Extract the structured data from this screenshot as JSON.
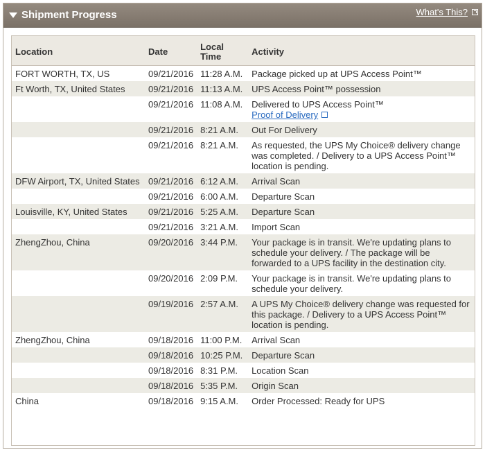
{
  "panel": {
    "title": "Shipment Progress",
    "help_link": "What's This?"
  },
  "columns": {
    "location": "Location",
    "date": "Date",
    "time_line1": "Local",
    "time_line2": "Time",
    "activity": "Activity"
  },
  "rows": [
    {
      "location": "FORT WORTH, TX, US",
      "date": "09/21/2016",
      "time": "11:28 A.M.",
      "activity": "Package picked up at UPS Access Point™",
      "link": ""
    },
    {
      "location": "Ft Worth, TX, United States",
      "date": "09/21/2016",
      "time": "11:13 A.M.",
      "activity": "UPS Access Point™ possession",
      "link": ""
    },
    {
      "location": "",
      "date": "09/21/2016",
      "time": "11:08 A.M.",
      "activity": "Delivered to UPS Access Point™",
      "link": "Proof of Delivery"
    },
    {
      "location": "",
      "date": "09/21/2016",
      "time": "8:21 A.M.",
      "activity": "Out For Delivery",
      "link": ""
    },
    {
      "location": "",
      "date": "09/21/2016",
      "time": "8:21 A.M.",
      "activity": "As requested, the UPS My Choice® delivery change was completed. / Delivery to a UPS Access Point™ location is pending.",
      "link": ""
    },
    {
      "location": "DFW Airport, TX, United States",
      "date": "09/21/2016",
      "time": "6:12 A.M.",
      "activity": "Arrival Scan",
      "link": ""
    },
    {
      "location": "",
      "date": "09/21/2016",
      "time": "6:00 A.M.",
      "activity": "Departure Scan",
      "link": ""
    },
    {
      "location": "Louisville, KY, United States",
      "date": "09/21/2016",
      "time": "5:25 A.M.",
      "activity": "Departure Scan",
      "link": ""
    },
    {
      "location": "",
      "date": "09/21/2016",
      "time": "3:21 A.M.",
      "activity": "Import Scan",
      "link": ""
    },
    {
      "location": "ZhengZhou, China",
      "date": "09/20/2016",
      "time": "3:44 P.M.",
      "activity": "Your package is in transit. We're updating plans to schedule your delivery. / The package will be forwarded to a UPS facility in the destination city.",
      "link": ""
    },
    {
      "location": "",
      "date": "09/20/2016",
      "time": "2:09 P.M.",
      "activity": "Your package is in transit. We're updating plans to schedule your delivery.",
      "link": ""
    },
    {
      "location": "",
      "date": "09/19/2016",
      "time": "2:57 A.M.",
      "activity": "A UPS My Choice® delivery change was requested for this package. / Delivery to a UPS Access Point™ location is pending.",
      "link": ""
    },
    {
      "location": "ZhengZhou, China",
      "date": "09/18/2016",
      "time": "11:00 P.M.",
      "activity": "Arrival Scan",
      "link": ""
    },
    {
      "location": "",
      "date": "09/18/2016",
      "time": "10:25 P.M.",
      "activity": "Departure Scan",
      "link": ""
    },
    {
      "location": "",
      "date": "09/18/2016",
      "time": "8:31 P.M.",
      "activity": "Location Scan",
      "link": ""
    },
    {
      "location": "",
      "date": "09/18/2016",
      "time": "5:35 P.M.",
      "activity": "Origin Scan",
      "link": ""
    },
    {
      "location": "China",
      "date": "09/18/2016",
      "time": "9:15 A.M.",
      "activity": "Order Processed: Ready for UPS",
      "link": ""
    }
  ]
}
